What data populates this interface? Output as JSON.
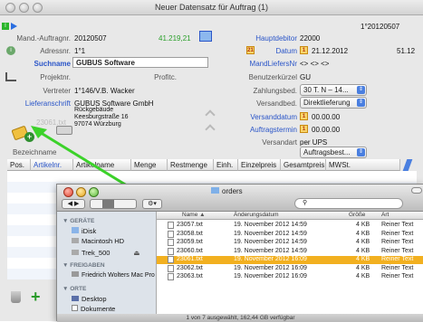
{
  "window": {
    "title": "Neuer Datensatz für Auftrag (1)"
  },
  "form": {
    "order_ref": "1°20120507",
    "mand_label": "Mand.-Auftragnr.",
    "mand_value": "20120507",
    "amount": "41.219,21",
    "hauptdebitor_label": "Hauptdebitor",
    "hauptdebitor_value": "22000",
    "adressnr_label": "Adressnr.",
    "adressnr_value": "1°1",
    "datum_label": "Datum",
    "datum_value": "21.12.2012",
    "datum_extra": "51.12",
    "suchname_label": "Suchname",
    "suchname_value": "GUBUS Software",
    "mandliefersnr_label": "MandLiefersNr",
    "mandliefersnr_value": "<> <> <>",
    "projektnr_label": "Projektnr.",
    "profitc_label": "Profitc.",
    "benutzerkuerzel_label": "Benutzerkürzel",
    "benutzerkuerzel_value": "GU",
    "vertreter_label": "Vertreter",
    "vertreter_value": "1°146/V.B. Wacker",
    "zahlungsbed_label": "Zahlungsbed.",
    "zahlungsbed_value": "30 T. N – 14...",
    "lieferanschrift_label": "Lieferanschrift",
    "lieferanschrift_lines": [
      "GUBUS Software GmbH",
      "Rückgebäude",
      "Keesburgstraße 16",
      "97074 Würzburg"
    ],
    "versandbed_label": "Versandbed.",
    "versandbed_value": "Direktlieferung",
    "versanddatum_label": "Versanddatum",
    "versanddatum_value": "00.00.00",
    "auftragstermin_label": "Auftragstermin",
    "auftragstermin_value": "00.00.00",
    "versandart_label": "Versandart",
    "versandart_value": "per UPS",
    "auftragsbest_value": "Auftragsbest...",
    "ghost_file": "23061.txt",
    "bezeichnung_label": "Bezeichname"
  },
  "table": {
    "columns": [
      "Pos.",
      "Artikelnr.",
      "Artikelname",
      "Menge",
      "Restmenge",
      "Einh.",
      "Einzelpreis",
      "Gesamtpreis",
      "MWSt."
    ]
  },
  "finder": {
    "title": "orders",
    "search_placeholder": "",
    "sidebar": {
      "devices_header": "▼ GERÄTE",
      "devices": [
        "iDisk",
        "Macintosh HD",
        "Trek_500"
      ],
      "shared_header": "▼ FREIGABEN",
      "shared": [
        "Friedrich Wolters Mac Pro"
      ],
      "places_header": "▼ ORTE",
      "places": [
        "Desktop",
        "Dokumente"
      ]
    },
    "columns": {
      "name": "Name",
      "date": "Änderungsdatum",
      "size": "Größe",
      "kind": "Art"
    },
    "files": [
      {
        "name": "23057.txt",
        "date": "19. November 2012 14:59",
        "size": "4 KB",
        "kind": "Reiner Text",
        "selected": false
      },
      {
        "name": "23058.txt",
        "date": "19. November 2012 14:59",
        "size": "4 KB",
        "kind": "Reiner Text",
        "selected": false
      },
      {
        "name": "23059.txt",
        "date": "19. November 2012 14:59",
        "size": "4 KB",
        "kind": "Reiner Text",
        "selected": false
      },
      {
        "name": "23060.txt",
        "date": "19. November 2012 14:59",
        "size": "4 KB",
        "kind": "Reiner Text",
        "selected": false
      },
      {
        "name": "23061.txt",
        "date": "19. November 2012 16:09",
        "size": "4 KB",
        "kind": "Reiner Text",
        "selected": true
      },
      {
        "name": "23062.txt",
        "date": "19. November 2012 16:09",
        "size": "4 KB",
        "kind": "Reiner Text",
        "selected": false
      },
      {
        "name": "23063.txt",
        "date": "19. November 2012 16:09",
        "size": "4 KB",
        "kind": "Reiner Text",
        "selected": false
      }
    ],
    "status": "1 von 7 ausgewählt, 162,44 GB verfügbar"
  },
  "colors": {
    "accent_blue": "#2a55c8",
    "amount_green": "#2aa02a",
    "selection_orange": "#f2b020",
    "drag_arrow_green": "#3cd22a"
  }
}
